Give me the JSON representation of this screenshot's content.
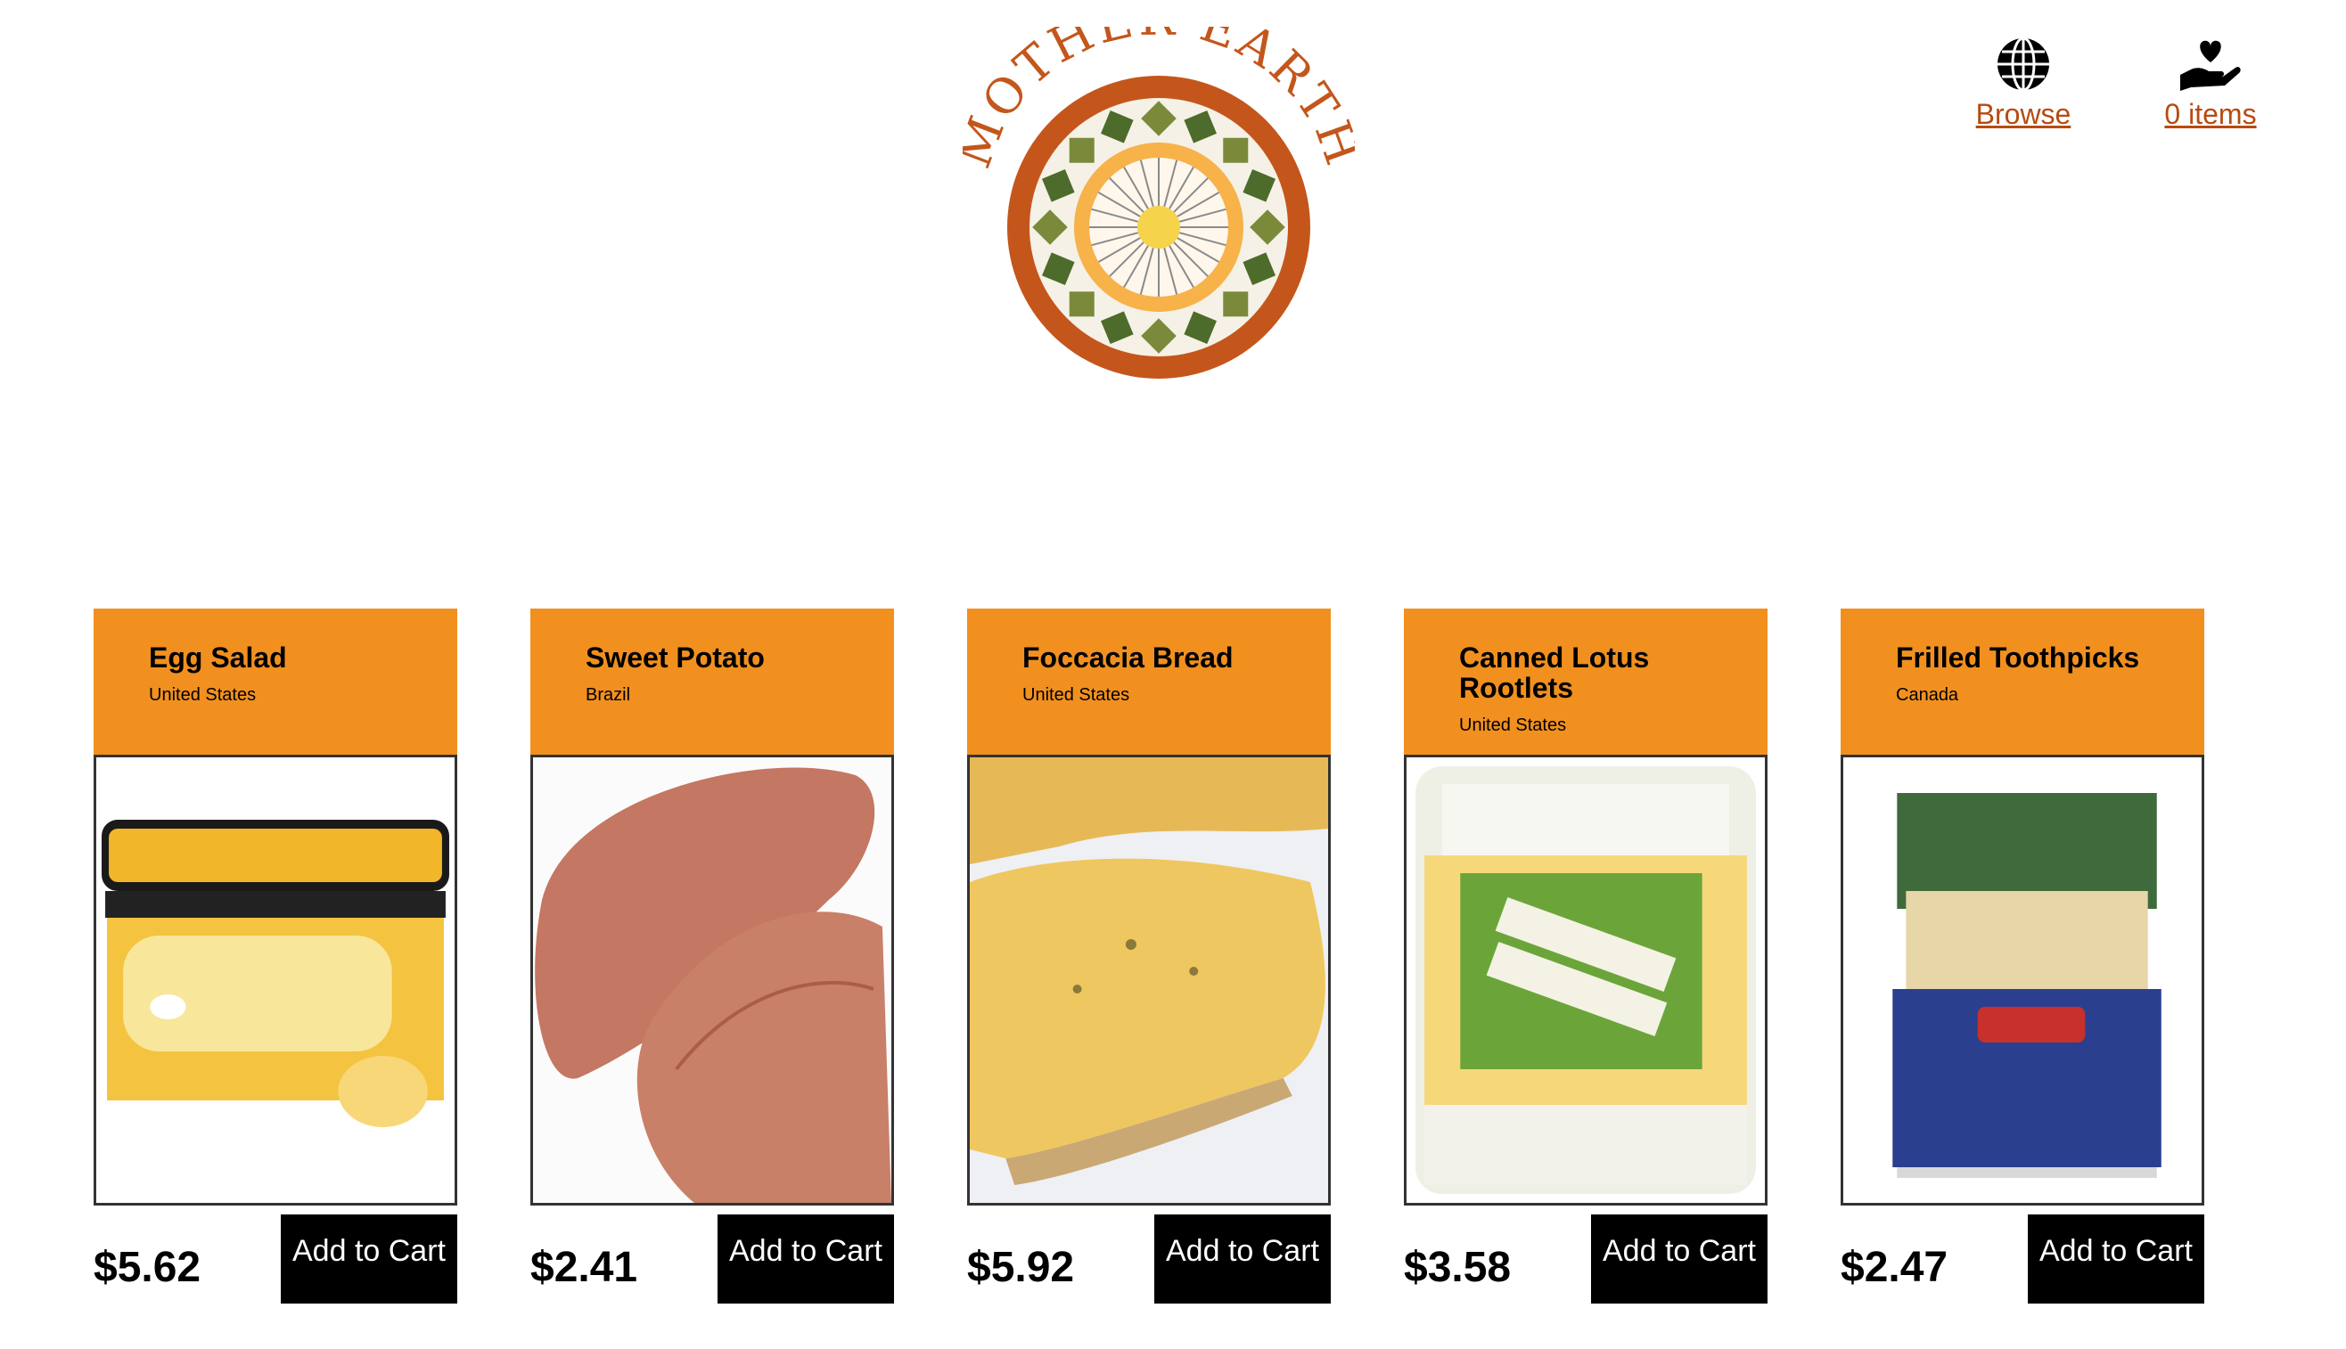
{
  "brand": {
    "name": "MOTHER EARTH",
    "accent": "#b84a10",
    "card_header": "#f1901f"
  },
  "nav": {
    "browse": {
      "label": "Browse",
      "icon": "globe-icon"
    },
    "cart": {
      "label": "0 items",
      "icon": "heart-hand-icon"
    }
  },
  "products": [
    {
      "name": "Egg Salad",
      "country": "United States",
      "price": "$5.62",
      "button": "Add to Cart"
    },
    {
      "name": "Sweet Potato",
      "country": "Brazil",
      "price": "$2.41",
      "button": "Add to Cart"
    },
    {
      "name": "Foccacia Bread",
      "country": "United States",
      "price": "$5.92",
      "button": "Add to Cart"
    },
    {
      "name": "Canned Lotus Rootlets",
      "country": "United States",
      "price": "$3.58",
      "button": "Add to Cart"
    },
    {
      "name": "Frilled Toothpicks",
      "country": "Canada",
      "price": "$2.47",
      "button": "Add to Cart"
    }
  ]
}
